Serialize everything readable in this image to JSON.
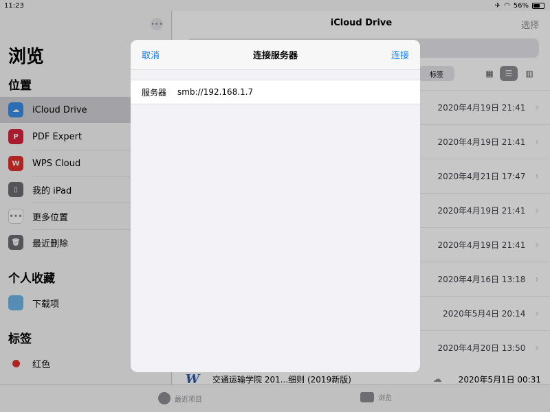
{
  "status": {
    "time": "11:23",
    "battery": "56%"
  },
  "sidebar": {
    "title": "浏览",
    "section_locations": "位置",
    "locations": [
      {
        "label": "iCloud Drive",
        "icon": "icloud-icon"
      },
      {
        "label": "PDF Expert",
        "icon": "pdf-expert-icon"
      },
      {
        "label": "WPS Cloud",
        "icon": "wps-icon"
      },
      {
        "label": "我的 iPad",
        "icon": "ipad-icon"
      },
      {
        "label": "更多位置",
        "icon": "more-icon"
      },
      {
        "label": "最近删除",
        "icon": "trash-icon"
      }
    ],
    "section_favorites": "个人收藏",
    "favorites": [
      {
        "label": "下载项",
        "icon": "folder-icon"
      }
    ],
    "section_tags": "标签",
    "tags": [
      {
        "label": "红色",
        "color": "#e0302c"
      }
    ]
  },
  "main": {
    "title": "iCloud Drive",
    "select_label": "选择",
    "tag_chip": "标签",
    "dates": [
      "2020年4月19日 21:41",
      "2020年4月19日 21:41",
      "2020年4月21日 17:47",
      "2020年4月19日 21:41",
      "2020年4月19日 21:41",
      "2020年4月16日 13:18",
      "2020年5月4日 20:14",
      "2020年4月20日 13:50"
    ],
    "last_file": {
      "name": "交通运输学院 201...细则 (2019新版)",
      "date": "2020年5月1日 00:31"
    }
  },
  "tabbar": {
    "recent": "最近项目",
    "browse": "浏览"
  },
  "modal": {
    "cancel": "取消",
    "title": "连接服务器",
    "connect": "连接",
    "server_label": "服务器",
    "server_value": "smb://192.168.1.7"
  },
  "colors": {
    "accent": "#0a7aff",
    "icloud": "#3a8ee6",
    "pdf_expert": "#d7263d",
    "wps": "#e0302c"
  }
}
